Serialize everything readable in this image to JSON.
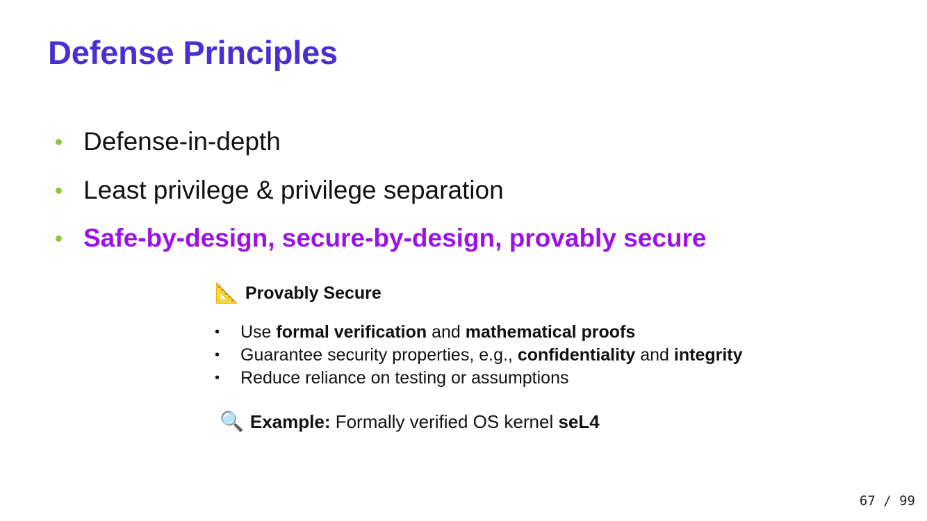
{
  "slide": {
    "title": "Defense Principles",
    "bullets": [
      {
        "text": "Defense-in-depth"
      },
      {
        "text": "Least privilege & privilege separation"
      },
      {
        "text": "Safe-by-design, secure-by-design, provably secure",
        "highlight_color": "#9a12e8"
      }
    ],
    "card": {
      "icon": "triangular-ruler-icon",
      "icon_glyph": "📐",
      "heading": "Provably Secure",
      "bullet_marker": "•",
      "items": [
        {
          "p1": "Use ",
          "b1": "formal verification",
          "p2": " and ",
          "b2": "mathematical proofs",
          "p3": ""
        },
        {
          "p1": "Guarantee security properties, e.g., ",
          "b1": "confidentiality",
          "p2": " and ",
          "b2": "integrity",
          "p3": ""
        },
        {
          "p1": "Reduce reliance on testing or assumptions",
          "b1": "",
          "p2": "",
          "b2": "",
          "p3": ""
        }
      ]
    },
    "example": {
      "icon": "magnifying-glass-icon",
      "icon_glyph": "🔍",
      "label": "Example:",
      "text": " Formally verified OS kernel ",
      "bold": "seL4"
    },
    "page_number": "67 / 99"
  },
  "colors": {
    "title": "#4a2fd2",
    "bullet_dot": "#8dc63f",
    "highlight": "#9a12e8"
  }
}
